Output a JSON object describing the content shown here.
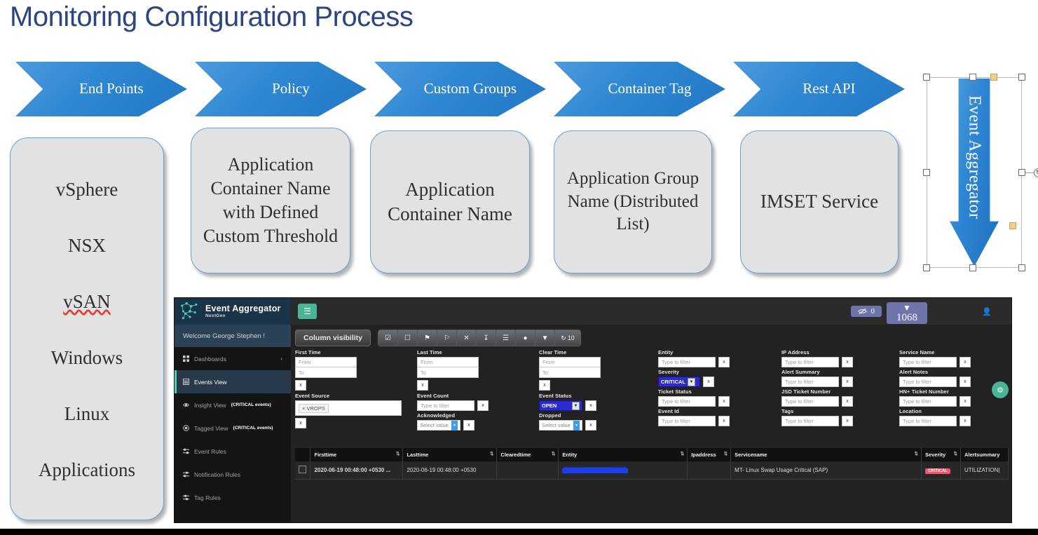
{
  "slide": {
    "title": "Monitoring Configuration Process",
    "title_color": "#2c4580"
  },
  "flow": {
    "arrows": [
      {
        "label": "End Points"
      },
      {
        "label": "Policy"
      },
      {
        "label": "Custom Groups"
      },
      {
        "label": "Container Tag"
      },
      {
        "label": "Rest API"
      }
    ],
    "boxes": [
      {
        "lines": [
          "vSphere",
          "NSX",
          "vSAN",
          "Windows",
          "Linux",
          "Applications"
        ]
      },
      {
        "text": "Application Container Name with Defined Custom Threshold"
      },
      {
        "text": "Application Container Name"
      },
      {
        "text": "Application Group Name (Distributed List)"
      },
      {
        "text": "IMSET Service"
      }
    ],
    "aggregator": {
      "label": "Event Aggregator"
    }
  },
  "app": {
    "brand": {
      "name": "Event Aggregator",
      "sub": "NextGen"
    },
    "welcome": "Welcome George Stephen !",
    "nav": [
      {
        "label": "Dashboards",
        "icon": "grid-icon",
        "badge": "",
        "chevron": "‹",
        "active": false
      },
      {
        "label": "Events View",
        "icon": "table-icon",
        "badge": "",
        "chevron": "",
        "active": true
      },
      {
        "label": "Insight View",
        "icon": "eye-icon",
        "badge": "(CRITICAL events)",
        "chevron": "",
        "active": false
      },
      {
        "label": "Tagged View",
        "icon": "target-icon",
        "badge": "(CRITICAL events)",
        "chevron": "",
        "active": false
      },
      {
        "label": "Event Rules",
        "icon": "sliders-icon",
        "badge": "",
        "chevron": "",
        "active": false
      },
      {
        "label": "Notification Rules",
        "icon": "sliders-icon",
        "badge": "",
        "chevron": "",
        "active": false
      },
      {
        "label": "Tag Rules",
        "icon": "sliders-icon",
        "badge": "",
        "chevron": "",
        "active": false
      }
    ],
    "topbar": {
      "menu_icon": "hamburger-icon",
      "hidden_badge": {
        "icon": "eye-slash-icon",
        "value": "0"
      },
      "count_badge": {
        "icon": "download-circle-icon",
        "value": "1068"
      },
      "user_icon": "user-icon"
    },
    "toolbar": {
      "column_visibility": "Column visibility",
      "buttons": [
        {
          "name": "select-all-icon",
          "glyph": "☑"
        },
        {
          "name": "deselect-all-icon",
          "glyph": "☐"
        },
        {
          "name": "flag-filled-icon",
          "glyph": "⚑"
        },
        {
          "name": "flag-outline-icon",
          "glyph": "⚐"
        },
        {
          "name": "clear-icon",
          "glyph": "✕"
        },
        {
          "name": "download-icon",
          "glyph": "↧"
        },
        {
          "name": "list-icon",
          "glyph": "☰"
        },
        {
          "name": "comment-icon",
          "glyph": "💬"
        },
        {
          "name": "filter-icon",
          "glyph": "▼"
        },
        {
          "name": "refresh-icon",
          "glyph": "↻",
          "text": "10"
        }
      ]
    },
    "filters": {
      "placeholder_filter": "Type to filter",
      "placeholder_from": "From",
      "placeholder_to": "To",
      "placeholder_select": "Select value",
      "clear_label": "x",
      "first_time": "First Time",
      "last_time": "Last Time",
      "clear_time": "Clear Time",
      "entity": "Entity",
      "severity": "Severity",
      "severity_value": "CRITICAL",
      "ticket_status": "Ticket Status",
      "event_id": "Event Id",
      "ip_address": "IP Address",
      "alert_summary": "Alert Summary",
      "jsd_ticket_number": "JSD Ticket Number",
      "tags": "Tags",
      "service_name": "Service Name",
      "alert_notes": "Alert Notes",
      "hn_ticket_number": "HN+ Ticket Number",
      "location": "Location",
      "event_source": "Event Source",
      "event_source_tag": "× VROPS",
      "event_count": "Event Count",
      "acknowledged": "Acknowledged",
      "event_status": "Event Status",
      "event_status_value": "OPEN",
      "dropped": "Dropped"
    },
    "gear_fab": "settings-gear-icon",
    "table": {
      "headers": [
        "",
        "Firsttime",
        "Lasttime",
        "Clearedtime",
        "Entity",
        "Ipaddress",
        "Servicename",
        "Severity",
        "Alertsummary"
      ],
      "rows": [
        {
          "checkbox": "",
          "firsttime": "2020-06-19 00:48:00 +0530 ...",
          "lasttime": "2020-06-19 00:48:00 +0530",
          "clearedtime": "",
          "entity": " ",
          "ipaddress": "",
          "servicename": "MT- Linux Swap Usage Critical (SAP)",
          "severity": "CRITICAL",
          "alertsummary": "UTILIZATION|"
        }
      ]
    }
  }
}
